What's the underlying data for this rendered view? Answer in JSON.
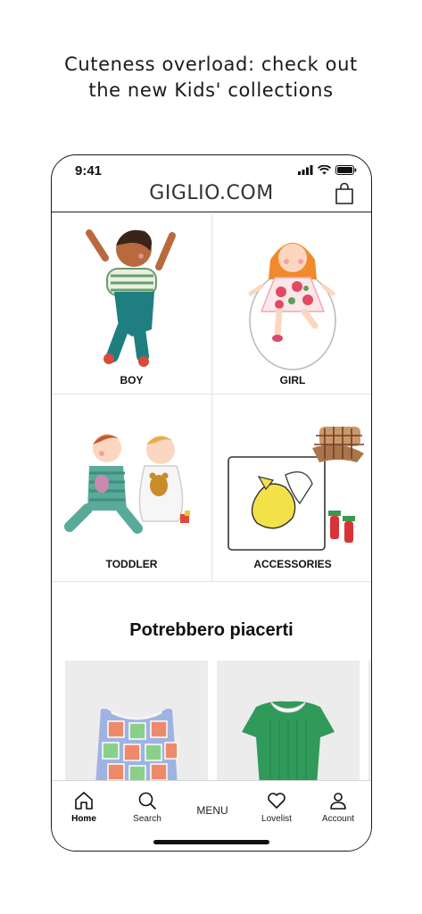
{
  "headline": {
    "line1": "Cuteness overload: check out",
    "line2": "the new Kids' collections"
  },
  "status_bar": {
    "time": "9:41"
  },
  "header": {
    "logo": "GIGLIO.COM",
    "bag_icon": "shopping-bag-icon"
  },
  "categories": [
    {
      "label": "BOY"
    },
    {
      "label": "GIRL"
    },
    {
      "label": "TODDLER"
    },
    {
      "label": "ACCESSORIES"
    }
  ],
  "recommendations": {
    "title": "Potrebbero piacerti",
    "products": [
      {
        "image": "crochet-vest"
      },
      {
        "image": "green-knit-romper"
      }
    ]
  },
  "tabbar": {
    "home": {
      "label": "Home",
      "icon": "home-icon"
    },
    "search": {
      "label": "Search",
      "icon": "search-icon"
    },
    "menu": {
      "label": "MENU"
    },
    "lovelist": {
      "label": "Lovelist",
      "icon": "heart-icon"
    },
    "account": {
      "label": "Account",
      "icon": "person-icon"
    }
  },
  "colors": {
    "border": "#1a1a1a",
    "divider": "#e3e3e3",
    "product_bg": "#ececec"
  }
}
